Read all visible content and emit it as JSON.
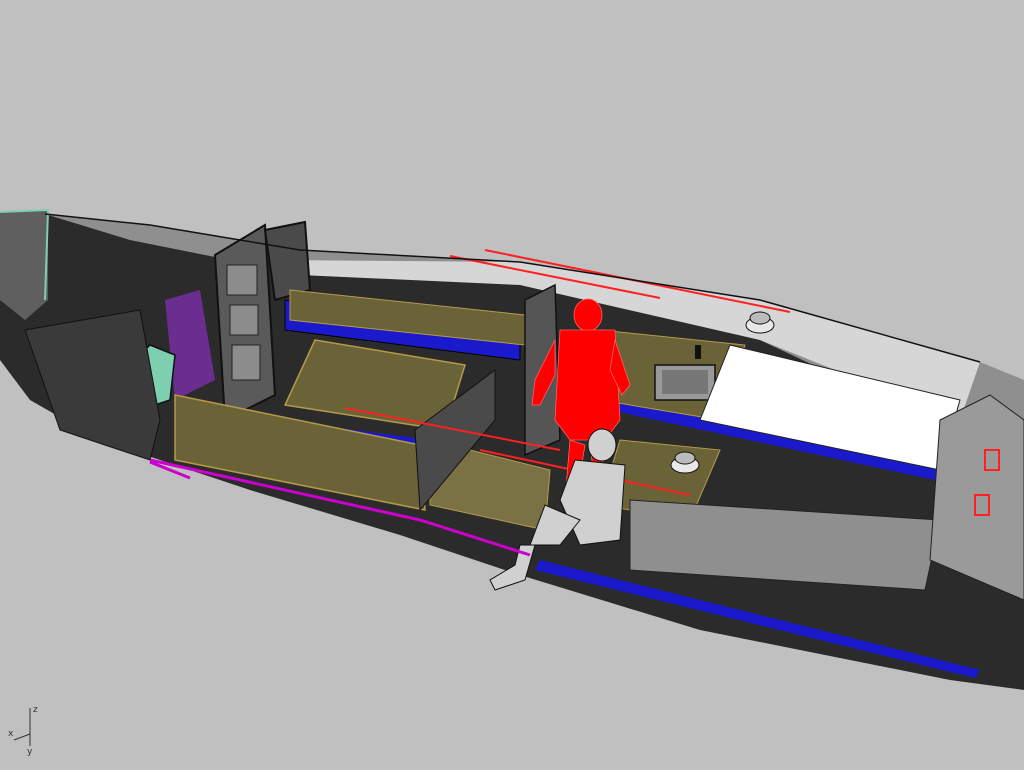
{
  "viewport": {
    "background": "#c0c0c0",
    "colors": {
      "hull_dark": "#2b2b2b",
      "hull_grey": "#8f8f8f",
      "deck_light": "#d3d3d3",
      "bench_olive": "#6b6338",
      "bench_edge": "#b59a4a",
      "cushion_blue": "#1a1acc",
      "cockpit_white": "#ffffff",
      "hull_trim_magenta": "#cc00cc",
      "bulkhead_teal": "#7ecfb0",
      "human_model_red": "#ff0000",
      "seated_model_mesh": "#222222",
      "hardware_red": "#ff2020"
    },
    "objects": [
      "hull",
      "deck",
      "forward-bulkhead",
      "galley-table",
      "bench-seats",
      "cushions",
      "sink",
      "cockpit-floor",
      "winch-starboard",
      "winch-port",
      "red-human-figure",
      "seated-mesh-figure",
      "traveler-track",
      "transom-fittings"
    ]
  },
  "axes": {
    "x_label": "x",
    "y_label": "y",
    "z_label": "z"
  }
}
